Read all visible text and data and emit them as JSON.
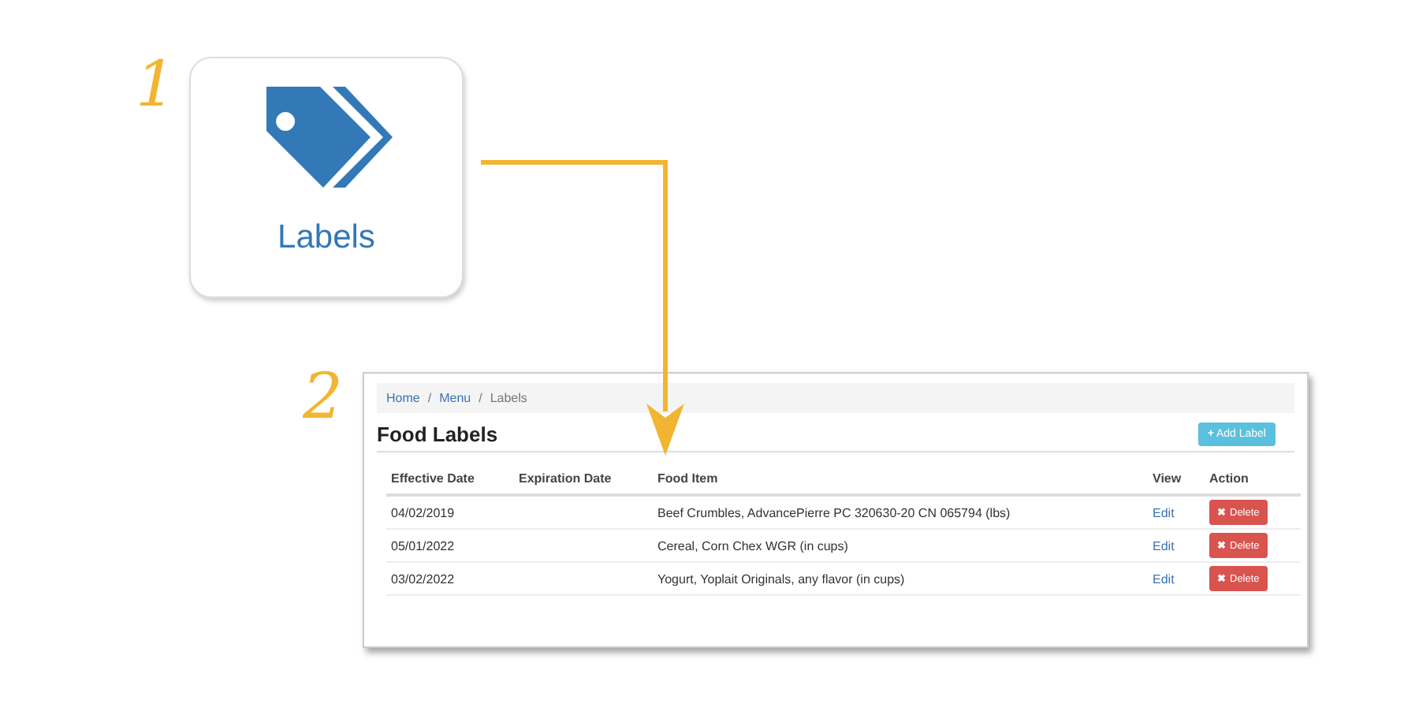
{
  "steps": [
    {
      "number": "1"
    },
    {
      "number": "2"
    }
  ],
  "tile": {
    "label": "Labels"
  },
  "breadcrumb": {
    "separator": "/",
    "items": [
      {
        "label": "Home",
        "current": false
      },
      {
        "label": "Menu",
        "current": false
      },
      {
        "label": "Labels",
        "current": true
      }
    ]
  },
  "page": {
    "title": "Food Labels",
    "add_button": "Add Label",
    "add_icon": "+"
  },
  "table": {
    "columns": [
      "Effective Date",
      "Expiration Date",
      "Food Item",
      "View",
      "Action"
    ],
    "rows": [
      {
        "effective_date": "04/02/2019",
        "food_item": "Beef Crumbles, AdvancePierre PC 320630-20 CN 065794 (lbs)",
        "view": "Edit",
        "action": "Delete",
        "action_icon": "✖"
      },
      {
        "effective_date": "05/01/2022",
        "food_item": "Cereal, Corn Chex WGR (in cups)",
        "view": "Edit",
        "action": "Delete",
        "action_icon": "✖"
      },
      {
        "effective_date": "03/02/2022",
        "food_item": "Yogurt, Yoplait Originals, any flavor (in cups)",
        "view": "Edit",
        "action": "Delete",
        "action_icon": "✖"
      }
    ]
  }
}
